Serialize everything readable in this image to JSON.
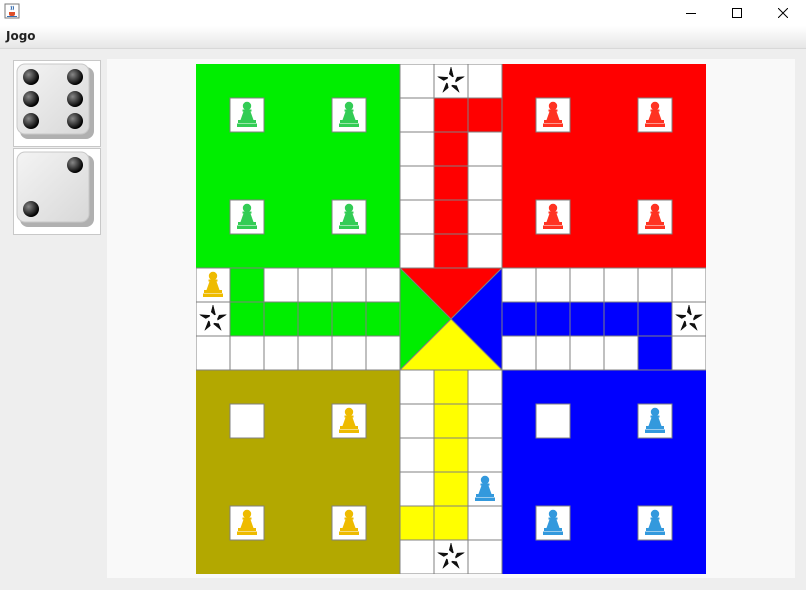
{
  "menu": {
    "items": [
      "Jogo"
    ]
  },
  "window": {
    "icons": {
      "app": "java-coffee-icon",
      "minimize": "minimize-icon",
      "maximize": "maximize-icon",
      "close": "close-icon"
    }
  },
  "dice": [
    {
      "name": "die-one",
      "value": 6
    },
    {
      "name": "die-two",
      "value": 2
    }
  ],
  "board": {
    "colors": {
      "green": "#00ee00",
      "red": "#ff0000",
      "blue": "#0000ff",
      "olive": "#b3a800",
      "yellow": "#ffff00",
      "lane_yellow": "#ffff00",
      "grid": "#808080",
      "pawn_green": "#33cc55",
      "pawn_red": "#ff3322",
      "pawn_yellow": "#eebb00",
      "pawn_blue": "#3399dd"
    },
    "yards": {
      "green": [
        "pawn",
        "pawn",
        "pawn",
        "pawn"
      ],
      "red": [
        "pawn",
        "pawn",
        "pawn",
        "pawn"
      ],
      "yellow": [
        "empty",
        "pawn",
        "pawn",
        "pawn"
      ],
      "blue": [
        "empty",
        "pawn",
        "pawn",
        "pawn"
      ]
    },
    "track_pawns": [
      {
        "color": "yellow",
        "row": 6,
        "col": 0
      },
      {
        "color": "blue",
        "row": 12,
        "col": 8
      }
    ],
    "star_icons": [
      {
        "row": 0,
        "col": 7
      },
      {
        "row": 7,
        "col": 0
      },
      {
        "row": 7,
        "col": 14
      },
      {
        "row": 14,
        "col": 7
      }
    ]
  }
}
